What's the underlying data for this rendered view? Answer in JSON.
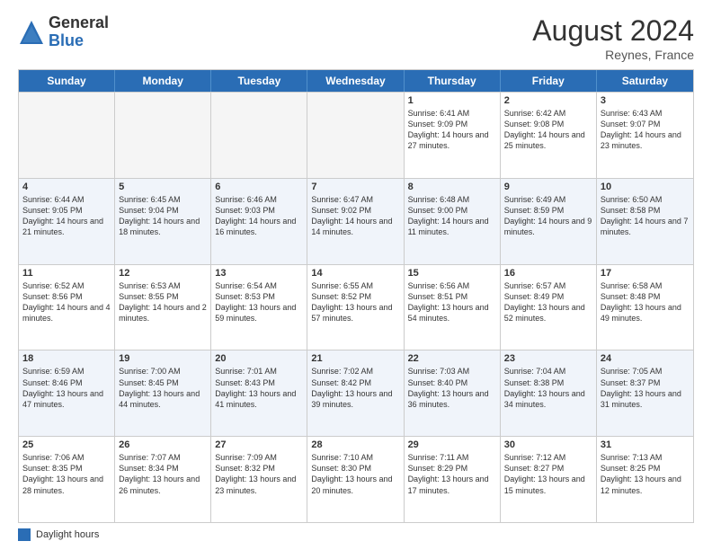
{
  "header": {
    "logo_general": "General",
    "logo_blue": "Blue",
    "month_year": "August 2024",
    "location": "Reynes, France"
  },
  "days_of_week": [
    "Sunday",
    "Monday",
    "Tuesday",
    "Wednesday",
    "Thursday",
    "Friday",
    "Saturday"
  ],
  "legend": {
    "label": "Daylight hours"
  },
  "weeks": [
    [
      {
        "day": "",
        "text": ""
      },
      {
        "day": "",
        "text": ""
      },
      {
        "day": "",
        "text": ""
      },
      {
        "day": "",
        "text": ""
      },
      {
        "day": "1",
        "text": "Sunrise: 6:41 AM\nSunset: 9:09 PM\nDaylight: 14 hours and 27 minutes."
      },
      {
        "day": "2",
        "text": "Sunrise: 6:42 AM\nSunset: 9:08 PM\nDaylight: 14 hours and 25 minutes."
      },
      {
        "day": "3",
        "text": "Sunrise: 6:43 AM\nSunset: 9:07 PM\nDaylight: 14 hours and 23 minutes."
      }
    ],
    [
      {
        "day": "4",
        "text": "Sunrise: 6:44 AM\nSunset: 9:05 PM\nDaylight: 14 hours and 21 minutes."
      },
      {
        "day": "5",
        "text": "Sunrise: 6:45 AM\nSunset: 9:04 PM\nDaylight: 14 hours and 18 minutes."
      },
      {
        "day": "6",
        "text": "Sunrise: 6:46 AM\nSunset: 9:03 PM\nDaylight: 14 hours and 16 minutes."
      },
      {
        "day": "7",
        "text": "Sunrise: 6:47 AM\nSunset: 9:02 PM\nDaylight: 14 hours and 14 minutes."
      },
      {
        "day": "8",
        "text": "Sunrise: 6:48 AM\nSunset: 9:00 PM\nDaylight: 14 hours and 11 minutes."
      },
      {
        "day": "9",
        "text": "Sunrise: 6:49 AM\nSunset: 8:59 PM\nDaylight: 14 hours and 9 minutes."
      },
      {
        "day": "10",
        "text": "Sunrise: 6:50 AM\nSunset: 8:58 PM\nDaylight: 14 hours and 7 minutes."
      }
    ],
    [
      {
        "day": "11",
        "text": "Sunrise: 6:52 AM\nSunset: 8:56 PM\nDaylight: 14 hours and 4 minutes."
      },
      {
        "day": "12",
        "text": "Sunrise: 6:53 AM\nSunset: 8:55 PM\nDaylight: 14 hours and 2 minutes."
      },
      {
        "day": "13",
        "text": "Sunrise: 6:54 AM\nSunset: 8:53 PM\nDaylight: 13 hours and 59 minutes."
      },
      {
        "day": "14",
        "text": "Sunrise: 6:55 AM\nSunset: 8:52 PM\nDaylight: 13 hours and 57 minutes."
      },
      {
        "day": "15",
        "text": "Sunrise: 6:56 AM\nSunset: 8:51 PM\nDaylight: 13 hours and 54 minutes."
      },
      {
        "day": "16",
        "text": "Sunrise: 6:57 AM\nSunset: 8:49 PM\nDaylight: 13 hours and 52 minutes."
      },
      {
        "day": "17",
        "text": "Sunrise: 6:58 AM\nSunset: 8:48 PM\nDaylight: 13 hours and 49 minutes."
      }
    ],
    [
      {
        "day": "18",
        "text": "Sunrise: 6:59 AM\nSunset: 8:46 PM\nDaylight: 13 hours and 47 minutes."
      },
      {
        "day": "19",
        "text": "Sunrise: 7:00 AM\nSunset: 8:45 PM\nDaylight: 13 hours and 44 minutes."
      },
      {
        "day": "20",
        "text": "Sunrise: 7:01 AM\nSunset: 8:43 PM\nDaylight: 13 hours and 41 minutes."
      },
      {
        "day": "21",
        "text": "Sunrise: 7:02 AM\nSunset: 8:42 PM\nDaylight: 13 hours and 39 minutes."
      },
      {
        "day": "22",
        "text": "Sunrise: 7:03 AM\nSunset: 8:40 PM\nDaylight: 13 hours and 36 minutes."
      },
      {
        "day": "23",
        "text": "Sunrise: 7:04 AM\nSunset: 8:38 PM\nDaylight: 13 hours and 34 minutes."
      },
      {
        "day": "24",
        "text": "Sunrise: 7:05 AM\nSunset: 8:37 PM\nDaylight: 13 hours and 31 minutes."
      }
    ],
    [
      {
        "day": "25",
        "text": "Sunrise: 7:06 AM\nSunset: 8:35 PM\nDaylight: 13 hours and 28 minutes."
      },
      {
        "day": "26",
        "text": "Sunrise: 7:07 AM\nSunset: 8:34 PM\nDaylight: 13 hours and 26 minutes."
      },
      {
        "day": "27",
        "text": "Sunrise: 7:09 AM\nSunset: 8:32 PM\nDaylight: 13 hours and 23 minutes."
      },
      {
        "day": "28",
        "text": "Sunrise: 7:10 AM\nSunset: 8:30 PM\nDaylight: 13 hours and 20 minutes."
      },
      {
        "day": "29",
        "text": "Sunrise: 7:11 AM\nSunset: 8:29 PM\nDaylight: 13 hours and 17 minutes."
      },
      {
        "day": "30",
        "text": "Sunrise: 7:12 AM\nSunset: 8:27 PM\nDaylight: 13 hours and 15 minutes."
      },
      {
        "day": "31",
        "text": "Sunrise: 7:13 AM\nSunset: 8:25 PM\nDaylight: 13 hours and 12 minutes."
      }
    ]
  ]
}
